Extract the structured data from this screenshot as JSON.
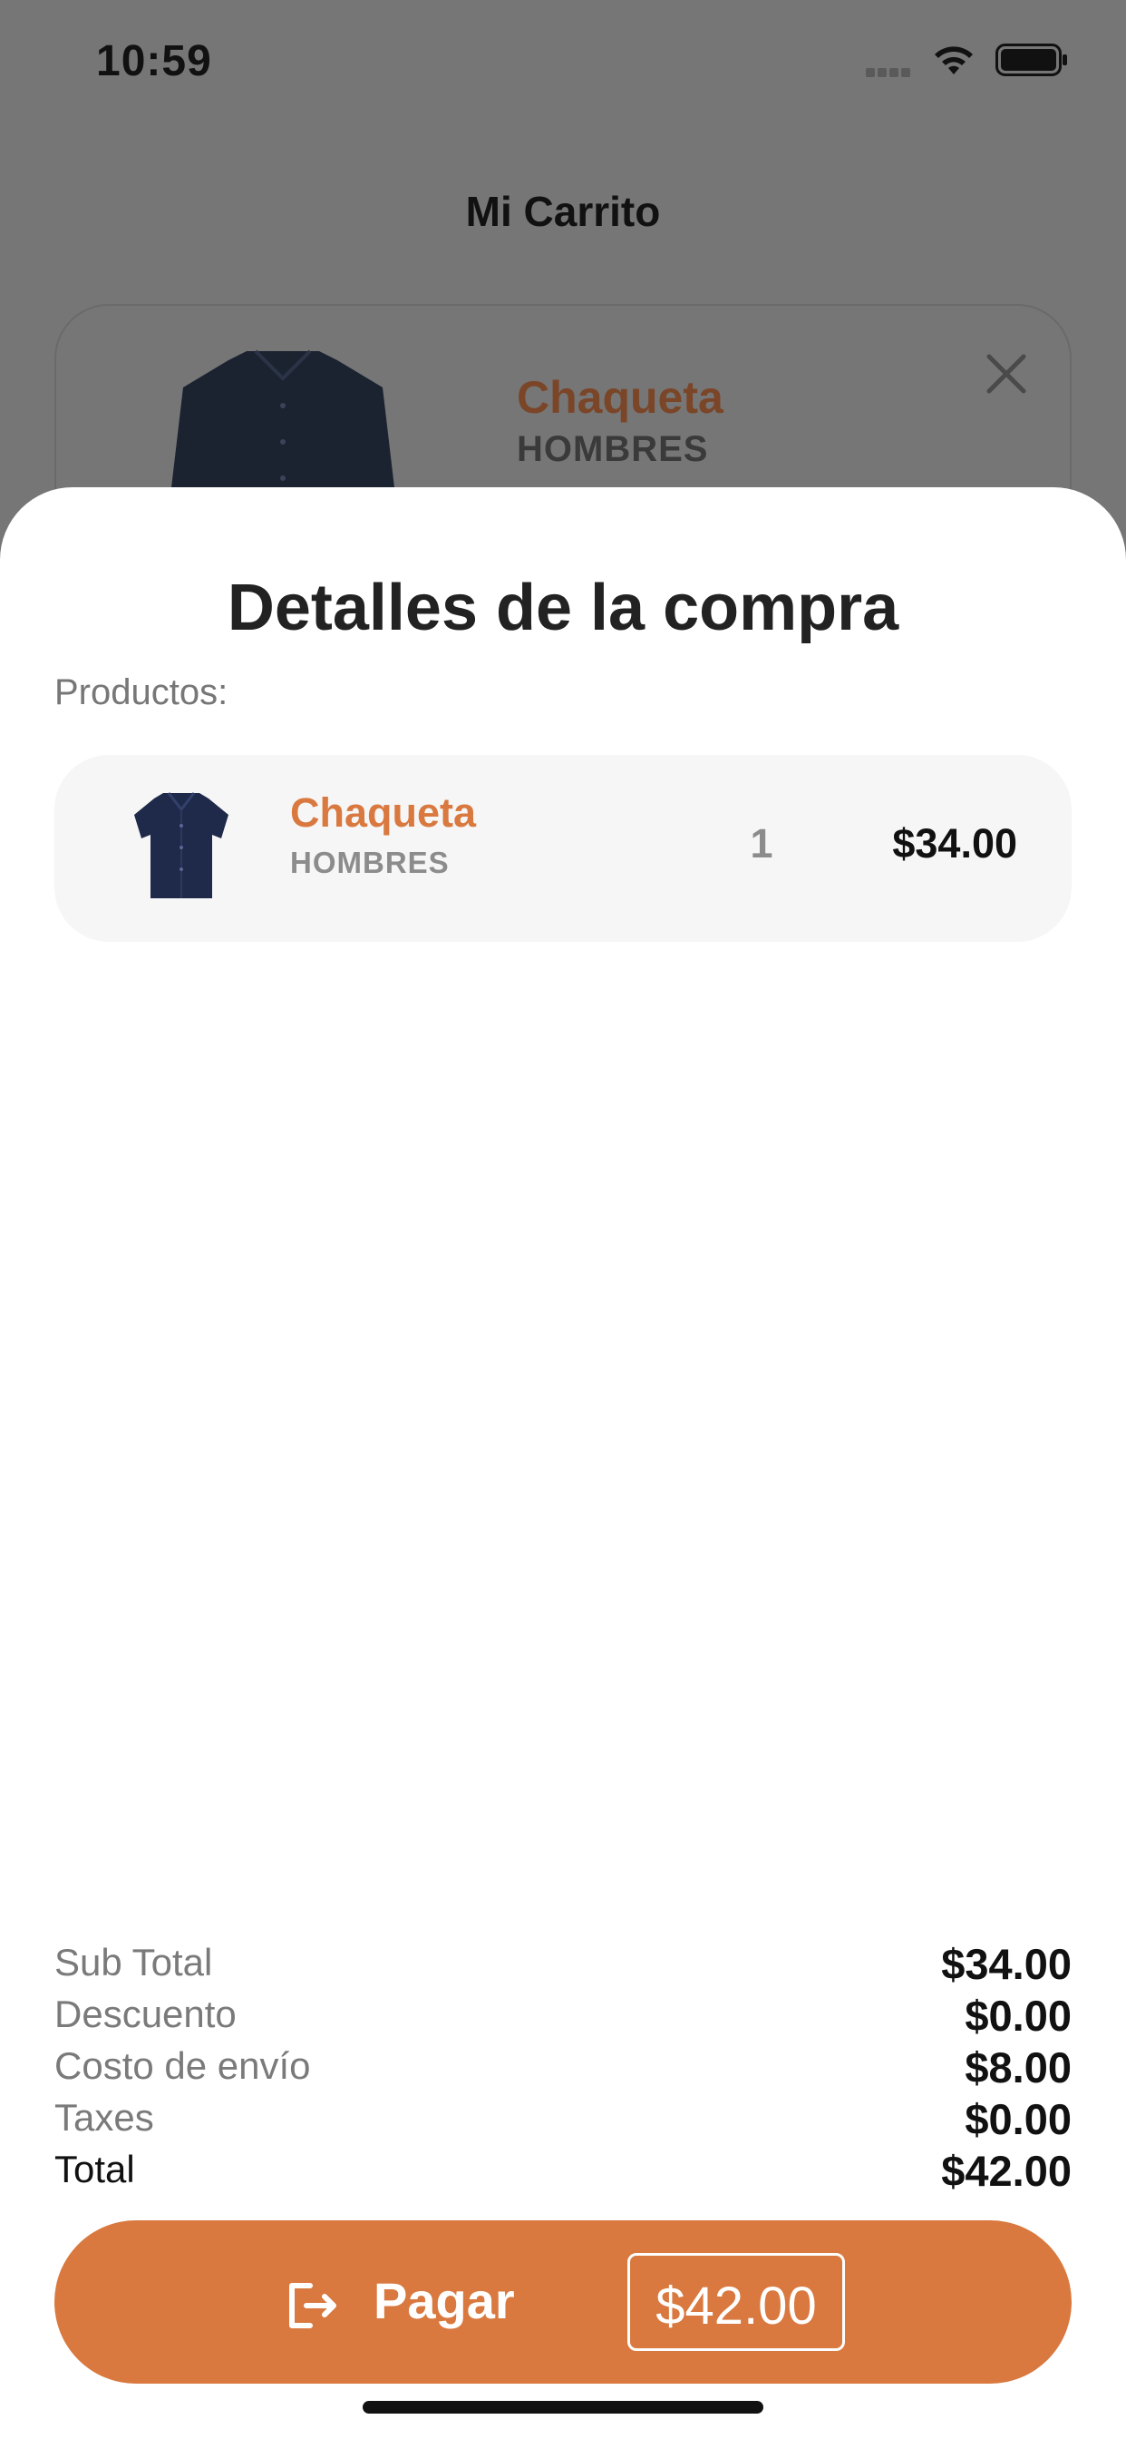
{
  "status_bar": {
    "time": "10:59"
  },
  "background_screen": {
    "title": "Mi Carrito",
    "item": {
      "name": "Chaqueta",
      "category": "HOMBRES"
    }
  },
  "sheet": {
    "title": "Detalles de la compra",
    "products_label": "Productos:",
    "products": [
      {
        "name": "Chaqueta",
        "category": "HOMBRES",
        "quantity": "1",
        "price": "$34.00"
      }
    ],
    "summary": [
      {
        "label": "Sub Total",
        "value": "$34.00"
      },
      {
        "label": "Descuento",
        "value": "$0.00"
      },
      {
        "label": "Costo de envío",
        "value": "$8.00"
      },
      {
        "label": "Taxes",
        "value": "$0.00"
      },
      {
        "label": "Total",
        "value": "$42.00"
      }
    ],
    "pay_button": {
      "label": "Pagar",
      "amount": "$42.00",
      "icon": "logout-arrow-icon"
    }
  },
  "colors": {
    "accent": "#d9793f",
    "overlay": "#767676",
    "sheet_bg": "#ffffff",
    "product_row_bg": "#f6f6f6"
  }
}
